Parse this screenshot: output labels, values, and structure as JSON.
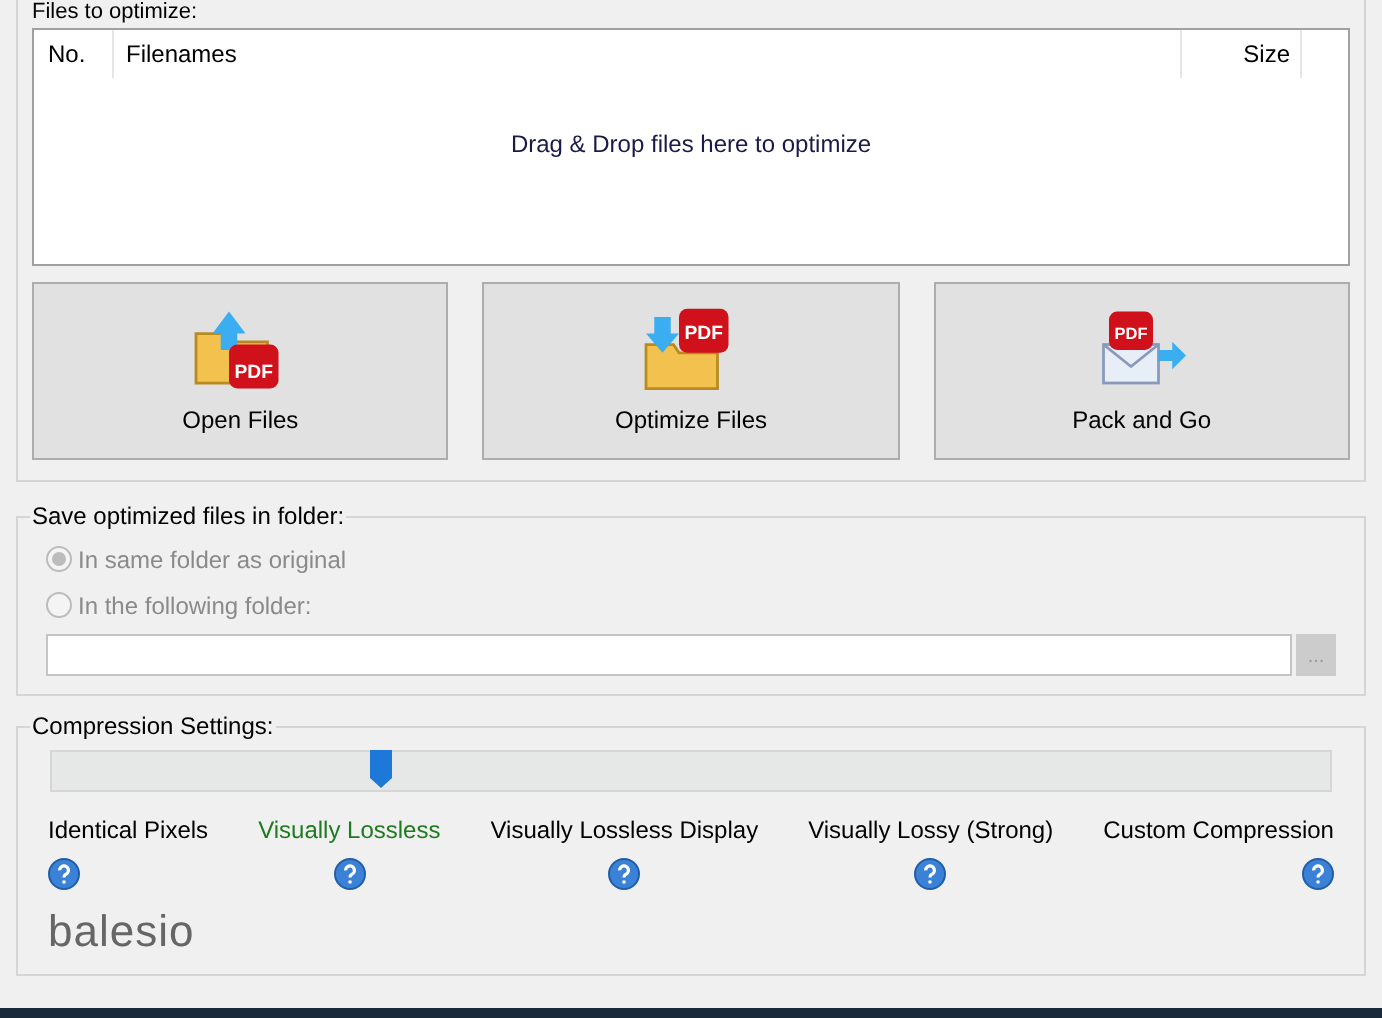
{
  "files_group": {
    "title": "Files to optimize:",
    "columns": [
      "No.",
      "Filenames",
      "Size"
    ],
    "empty_hint": "Drag & Drop files here to optimize"
  },
  "actions": [
    {
      "label": "Open Files",
      "kind": "open",
      "badge": "PDF"
    },
    {
      "label": "Optimize Files",
      "kind": "optimize",
      "badge": "PDF"
    },
    {
      "label": "Pack and Go",
      "kind": "pack",
      "badge": "PDF"
    }
  ],
  "save_group": {
    "title": "Save optimized files in folder:",
    "disabled": true,
    "options": [
      {
        "label": "In same folder as original",
        "selected": true
      },
      {
        "label": "In the following folder:",
        "selected": false
      }
    ],
    "browse_label": "..."
  },
  "compression": {
    "title": "Compression Settings:",
    "level": 0.25,
    "presets": [
      {
        "label": "Identical Pixels",
        "selected": false
      },
      {
        "label": "Visually Lossless",
        "selected": true
      },
      {
        "label": "Visually Lossless Display",
        "selected": false
      },
      {
        "label": "Visually Lossy (Strong)",
        "selected": false
      },
      {
        "label": "Custom Compression",
        "selected": false
      }
    ]
  },
  "logo": {
    "text": "balesio"
  }
}
